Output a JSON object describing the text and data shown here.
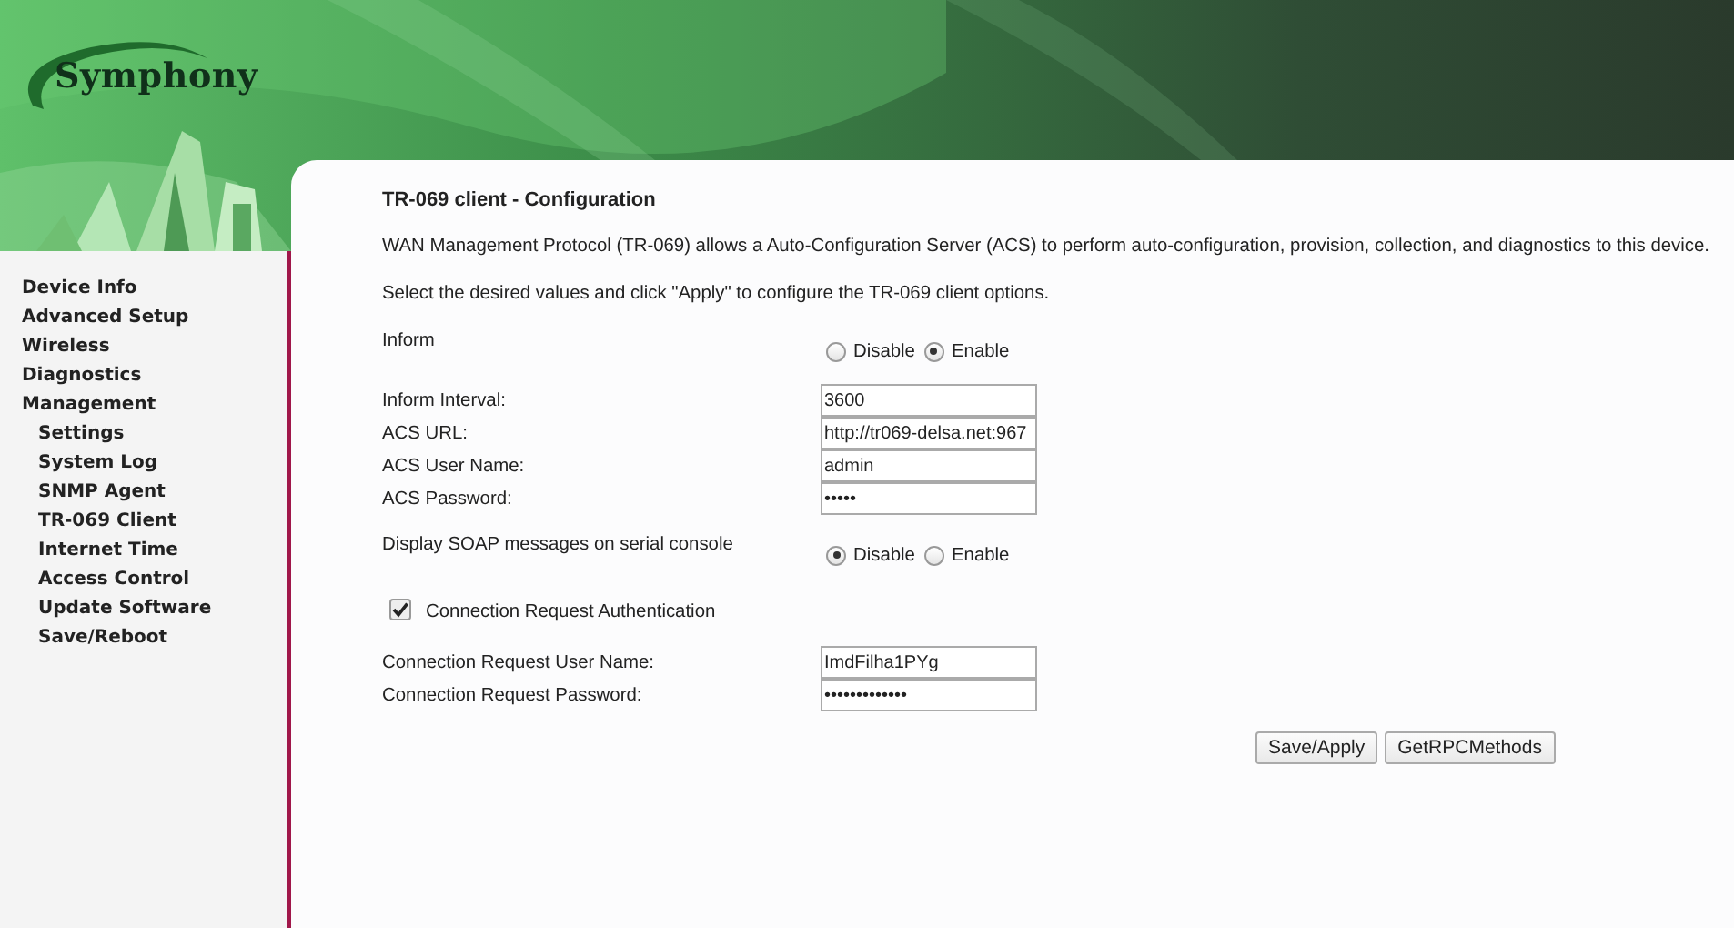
{
  "logo": {
    "text": "Symphony"
  },
  "sidebar": {
    "items": [
      {
        "label": "Device Info"
      },
      {
        "label": "Advanced Setup"
      },
      {
        "label": "Wireless"
      },
      {
        "label": "Diagnostics"
      },
      {
        "label": "Management",
        "children": [
          {
            "label": "Settings"
          },
          {
            "label": "System Log"
          },
          {
            "label": "SNMP Agent"
          },
          {
            "label": "TR-069 Client"
          },
          {
            "label": "Internet Time"
          },
          {
            "label": "Access Control"
          },
          {
            "label": "Update Software"
          },
          {
            "label": "Save/Reboot"
          }
        ]
      }
    ]
  },
  "page": {
    "title": "TR-069 client - Configuration",
    "description": "WAN Management Protocol (TR-069) allows a Auto-Configuration Server (ACS) to perform auto-configuration, provision, collection, and diagnostics to this device.",
    "instruction": "Select the desired values and click \"Apply\" to configure the TR-069 client options."
  },
  "form": [
    {
      "kind": "radio",
      "label": "Inform",
      "options": [
        {
          "label": "Disable",
          "selected": false
        },
        {
          "label": "Enable",
          "selected": true
        }
      ]
    },
    {
      "kind": "field",
      "label": "Inform Interval:",
      "value": "3600"
    },
    {
      "kind": "field",
      "label": "ACS URL:",
      "value": "http://tr069-delsa.net:967"
    },
    {
      "kind": "field",
      "label": "ACS User Name:",
      "value": "admin"
    },
    {
      "kind": "field",
      "label": "ACS Password:",
      "value": "•••••"
    },
    {
      "kind": "radio",
      "label": "Display SOAP messages on serial console",
      "options": [
        {
          "label": "Disable",
          "selected": true
        },
        {
          "label": "Enable",
          "selected": false
        }
      ]
    },
    {
      "kind": "checkbox",
      "label": "Connection Request Authentication",
      "checked": true
    },
    {
      "kind": "field",
      "label": "Connection Request User Name:",
      "value": "ImdFilha1PYg"
    },
    {
      "kind": "field",
      "label": "Connection Request Password:",
      "value": "•••••••••••••"
    }
  ],
  "buttons": [
    "Save/Apply",
    "GetRPCMethods"
  ]
}
